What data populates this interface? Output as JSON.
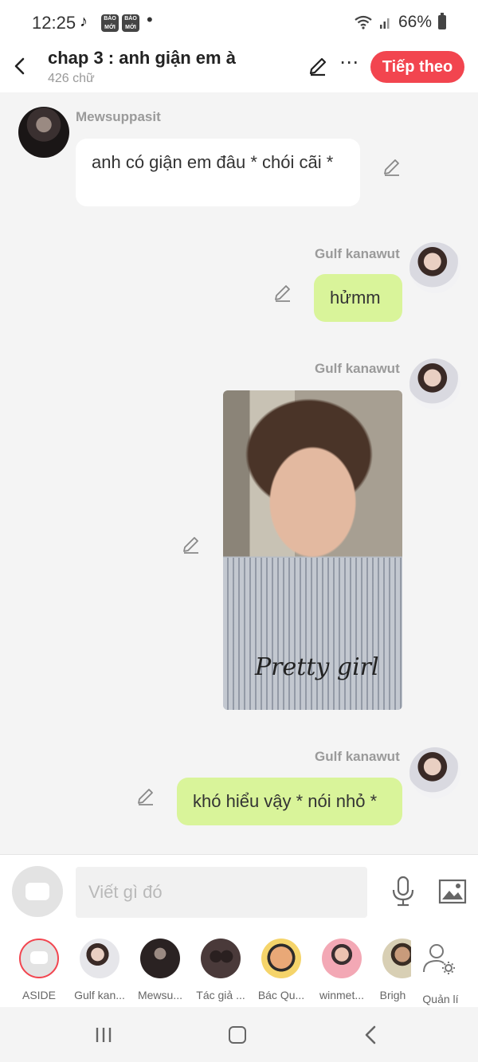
{
  "status_bar": {
    "time": "12:25",
    "app_badges": [
      "BÁO MỚI",
      "BÁO MỚI"
    ],
    "battery": "66%"
  },
  "header": {
    "title": "chap 3 : anh giận em à",
    "subtitle": "426 chữ",
    "next_label": "Tiếp theo"
  },
  "messages": [
    {
      "sender": "Mewsuppasit",
      "text": "anh có giận em đâu * chói cãi *",
      "side": "left"
    },
    {
      "sender": "Gulf kanawut",
      "text": "hửmm",
      "side": "right"
    },
    {
      "sender": "Gulf kanawut",
      "image": "photo",
      "side": "right",
      "image_print": "Pretty girl"
    },
    {
      "sender": "Gulf kanawut",
      "text": "khó hiểu vậy * nói nhỏ *",
      "side": "right"
    }
  ],
  "composer": {
    "placeholder": "Viết gì đó"
  },
  "characters": [
    {
      "name": "ASIDE"
    },
    {
      "name": "Gulf kan..."
    },
    {
      "name": "Mewsu..."
    },
    {
      "name": "Tác giả ..."
    },
    {
      "name": "Bác Qu..."
    },
    {
      "name": "winmet..."
    },
    {
      "name": "Brigh"
    },
    {
      "name": "Quản lí"
    }
  ],
  "colors": {
    "accent": "#f2454f",
    "own_bubble": "#d9f49a",
    "other_bubble": "#ffffff",
    "background": "#f4f4f4"
  },
  "icons": [
    "back-arrow-icon",
    "pencil-icon",
    "more-dots-icon",
    "microphone-icon",
    "image-icon",
    "user-settings-icon",
    "tiktok-icon",
    "wifi-icon",
    "signal-icon",
    "battery-icon"
  ]
}
